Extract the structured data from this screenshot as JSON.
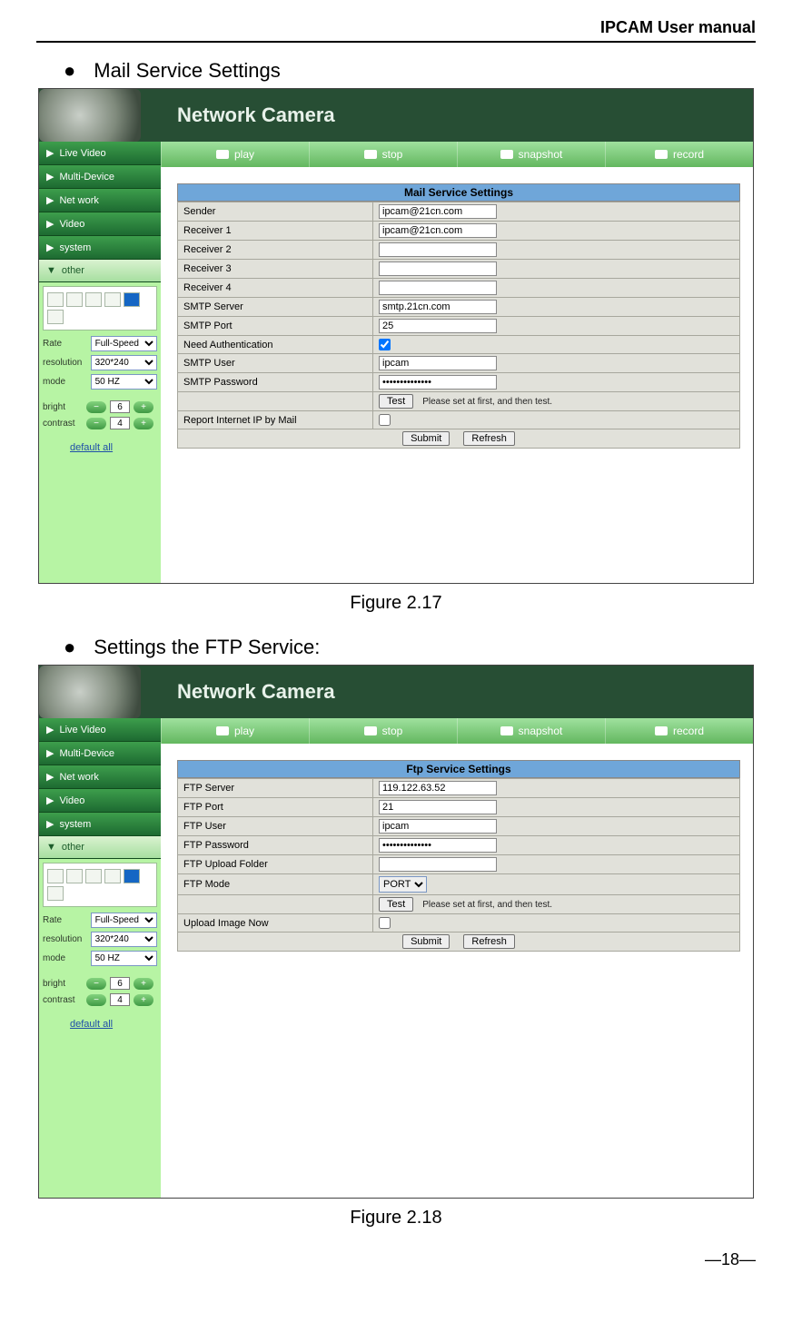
{
  "doc": {
    "header": "IPCAM User manual",
    "page_number": "—18—",
    "bullet1": "Mail Service Settings",
    "bullet2": "Settings the FTP Service:",
    "fig1": "Figure 2.17",
    "fig2": "Figure 2.18"
  },
  "nc_title": "Network Camera",
  "topbar": {
    "play": "play",
    "stop": "stop",
    "snapshot": "snapshot",
    "record": "record"
  },
  "sidebar": {
    "items": [
      "Live Video",
      "Multi-Device",
      "Net work",
      "Video",
      "system",
      "other"
    ],
    "rate_label": "Rate",
    "rate_value": "Full-Speed",
    "resolution_label": "resolution",
    "resolution_value": "320*240",
    "mode_label": "mode",
    "mode_value": "50 HZ",
    "bright_label": "bright",
    "bright_value": "6",
    "contrast_label": "contrast",
    "contrast_value": "4",
    "default": "default all"
  },
  "mail": {
    "title": "Mail Service Settings",
    "rows": {
      "sender_l": "Sender",
      "sender_v": "ipcam@21cn.com",
      "r1_l": "Receiver 1",
      "r1_v": "ipcam@21cn.com",
      "r2_l": "Receiver 2",
      "r2_v": "",
      "r3_l": "Receiver 3",
      "r3_v": "",
      "r4_l": "Receiver 4",
      "r4_v": "",
      "srv_l": "SMTP Server",
      "srv_v": "smtp.21cn.com",
      "port_l": "SMTP Port",
      "port_v": "25",
      "auth_l": "Need Authentication",
      "user_l": "SMTP User",
      "user_v": "ipcam",
      "pass_l": "SMTP Password",
      "pass_v": "••••••••••••••",
      "test_btn": "Test",
      "test_hint": "Please set at first, and then test.",
      "report_l": "Report Internet IP by Mail",
      "submit": "Submit",
      "refresh": "Refresh"
    }
  },
  "ftp": {
    "title": "Ftp Service Settings",
    "rows": {
      "srv_l": "FTP Server",
      "srv_v": "119.122.63.52",
      "port_l": "FTP Port",
      "port_v": "21",
      "user_l": "FTP User",
      "user_v": "ipcam",
      "pass_l": "FTP Password",
      "pass_v": "••••••••••••••",
      "folder_l": "FTP Upload Folder",
      "folder_v": "",
      "mode_l": "FTP Mode",
      "mode_v": "PORT",
      "test_btn": "Test",
      "test_hint": "Please set at first, and then test.",
      "upload_l": "Upload Image Now",
      "submit": "Submit",
      "refresh": "Refresh"
    }
  }
}
